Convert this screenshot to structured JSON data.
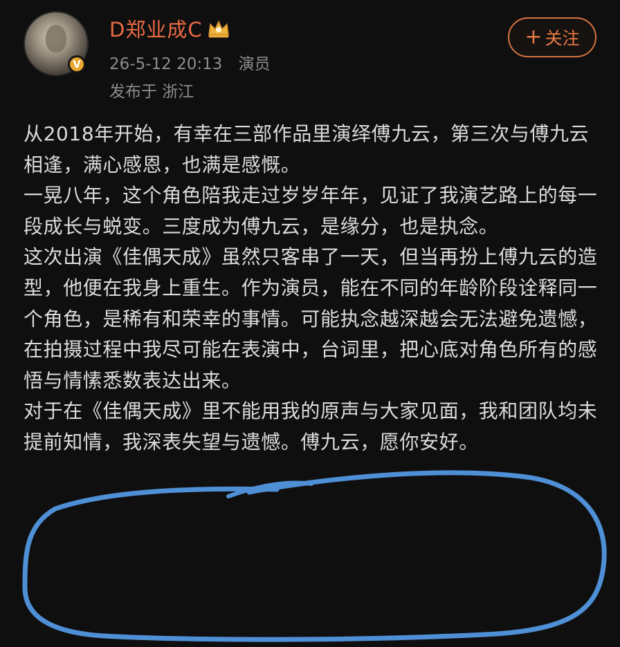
{
  "user": {
    "name": "D郑业成C",
    "timestamp": "26-5-12 20:13",
    "role": "演员",
    "location": "发布于 浙江",
    "verified_badge": "V"
  },
  "follow_button": {
    "icon": "plus-icon",
    "plus": "+",
    "label": "关注"
  },
  "post": {
    "paragraphs": [
      "从2018年开始，有幸在三部作品里演绎傅九云，第三次与傅九云相逢，满心感恩，也满是感慨。",
      "一晃八年，这个角色陪我走过岁岁年年，见证了我演艺路上的每一段成长与蜕变。三度成为傅九云，是缘分，也是执念。",
      "这次出演《佳偶天成》虽然只客串了一天，但当再扮上傅九云的造型，他便在我身上重生。作为演员，能在不同的年龄阶段诠释同一个角色，是稀有和荣幸的事情。可能执念越深越会无法避免遗憾，在拍摄过程中我尽可能在表演中，台词里，把心底对角色所有的感悟与情愫悉数表达出来。",
      "对于在《佳偶天成》里不能用我的原声与大家见面，我和团队均未提前知情，我深表失望与遗憾。傅九云，愿你安好。"
    ]
  },
  "colors": {
    "background": "#0f0f0f",
    "username": "#ea6b43",
    "meta_text": "#8d8d8d",
    "body_text": "#dcdcdc",
    "annotation_circle": "#4f8fd6",
    "badge": "#e8a72f"
  }
}
